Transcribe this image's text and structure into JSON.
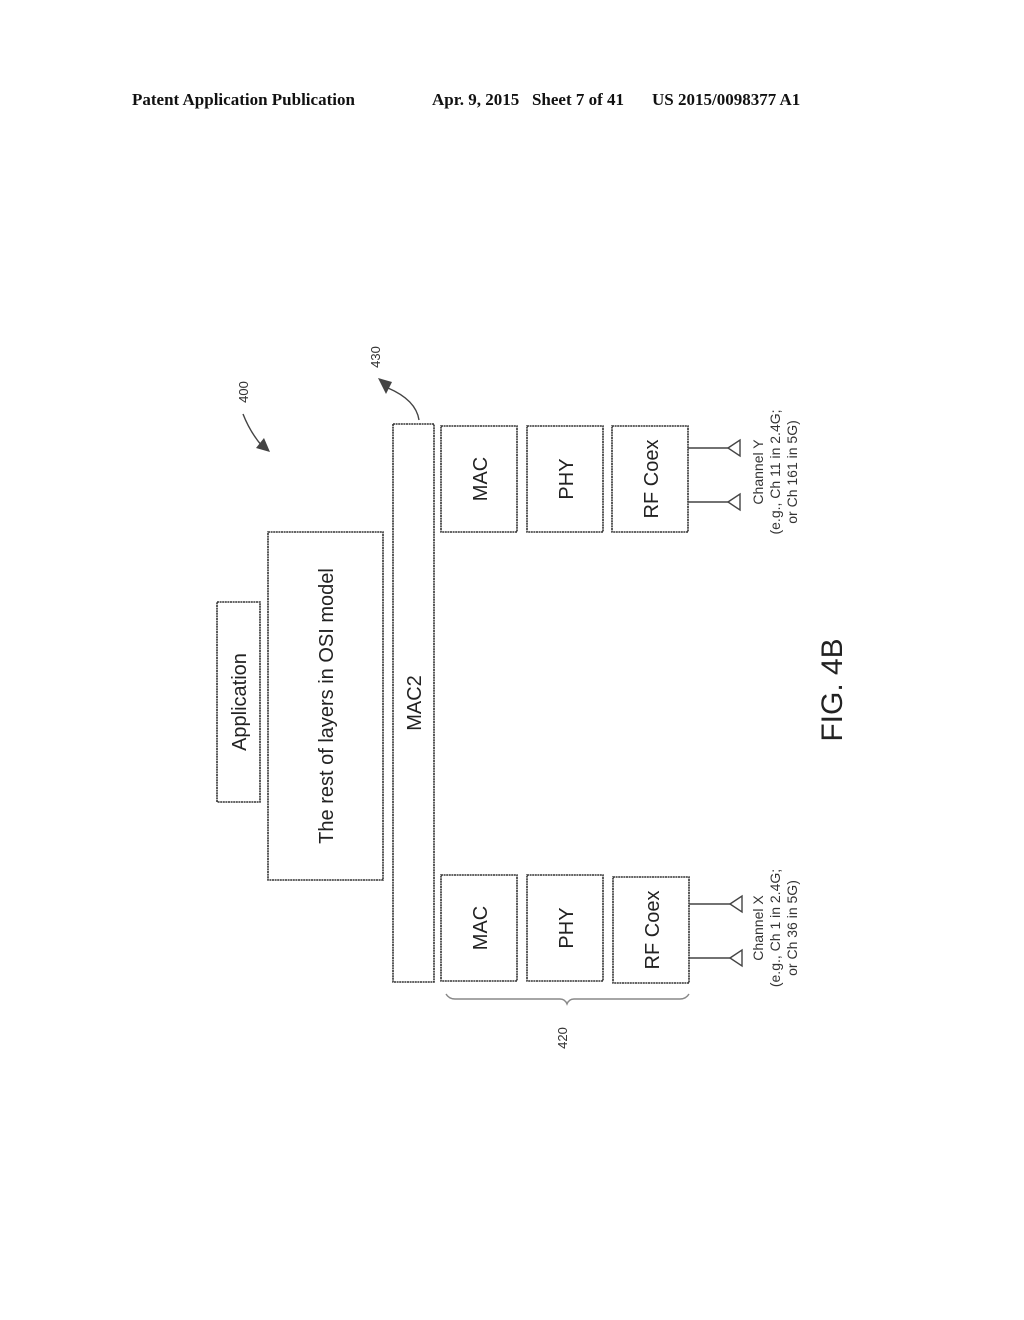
{
  "header": {
    "publication": "Patent Application Publication",
    "date_sheet": "Apr. 9, 2015   Sheet 7 of 41",
    "number": "US 2015/0098377 A1"
  },
  "figure": {
    "label": "FIG. 4B",
    "ref_system": "400",
    "ref_mac2": "430",
    "ref_group": "420",
    "blocks": {
      "application": "Application",
      "osi_rest": "The rest of layers in OSI model",
      "mac2": "MAC2",
      "upper_stack": [
        "MAC",
        "PHY",
        "RF Coex"
      ],
      "lower_stack": [
        "MAC",
        "PHY",
        "RF Coex"
      ]
    },
    "channel_y": {
      "line1": "Channel Y",
      "line2": "(e.g., Ch 11 in 2.4G;",
      "line3": "or Ch 161 in 5G)"
    },
    "channel_x": {
      "line1": "Channel X",
      "line2": "(e.g., Ch 1 in 2.4G;",
      "line3": "or Ch 36 in 5G)"
    }
  }
}
